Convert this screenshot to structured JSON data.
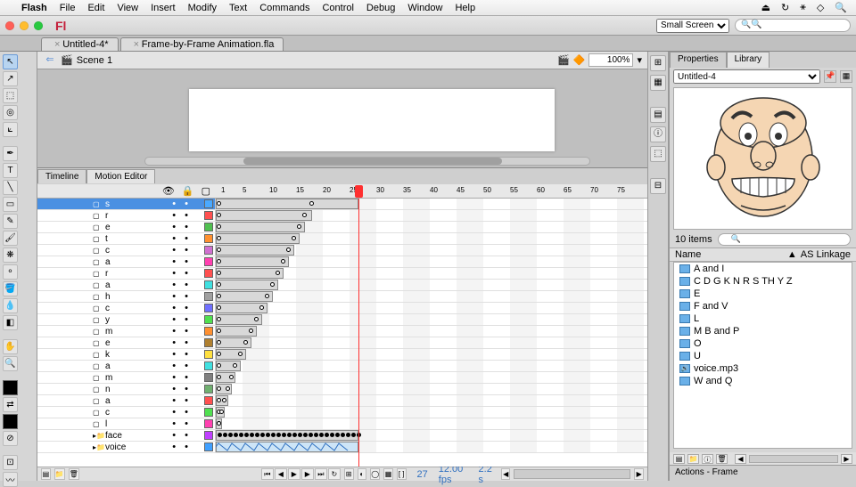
{
  "menubar": {
    "items": [
      "Flash",
      "File",
      "Edit",
      "View",
      "Insert",
      "Modify",
      "Text",
      "Commands",
      "Control",
      "Debug",
      "Window",
      "Help"
    ]
  },
  "titlebar": {
    "logo": "Fl",
    "workspace": "Small Screen",
    "search_placeholder": ""
  },
  "doctabs": [
    {
      "label": "Untitled-4*"
    },
    {
      "label": "Frame-by-Frame Animation.fla"
    }
  ],
  "scenebar": {
    "scene": "Scene 1",
    "zoom": "100%"
  },
  "timeline": {
    "tabs": [
      "Timeline",
      "Motion Editor"
    ],
    "ruler_ticks": [
      1,
      5,
      10,
      15,
      20,
      25,
      30,
      35,
      40,
      45,
      50,
      55,
      60,
      65,
      70,
      75
    ],
    "playhead_frame": 27,
    "status": {
      "frame": "27",
      "fps": "12.00 fps",
      "time": "2.2 s"
    },
    "layers": [
      {
        "name": "s",
        "color": "#4aa9ff",
        "selected": true,
        "start": 0,
        "end": 160,
        "kfs": [
          0,
          108
        ]
      },
      {
        "name": "r",
        "color": "#ff5050",
        "start": 0,
        "end": 108,
        "kfs": [
          0,
          100
        ]
      },
      {
        "name": "e",
        "color": "#50c050",
        "start": 0,
        "end": 100,
        "kfs": [
          0,
          94
        ]
      },
      {
        "name": "t",
        "color": "#ff9030",
        "start": 0,
        "end": 94,
        "kfs": [
          0,
          88
        ]
      },
      {
        "name": "c",
        "color": "#d070d0",
        "start": 0,
        "end": 88,
        "kfs": [
          0,
          82
        ]
      },
      {
        "name": "a",
        "color": "#ff40b0",
        "start": 0,
        "end": 82,
        "kfs": [
          0,
          76
        ]
      },
      {
        "name": "r",
        "color": "#ff5050",
        "start": 0,
        "end": 76,
        "kfs": [
          0,
          70
        ]
      },
      {
        "name": "a",
        "color": "#40e0e0",
        "start": 0,
        "end": 70,
        "kfs": [
          0,
          64
        ]
      },
      {
        "name": "h",
        "color": "#a0a0a0",
        "start": 0,
        "end": 64,
        "kfs": [
          0,
          58
        ]
      },
      {
        "name": "c",
        "color": "#7070ff",
        "start": 0,
        "end": 58,
        "kfs": [
          0,
          52
        ]
      },
      {
        "name": "y",
        "color": "#50e050",
        "start": 0,
        "end": 52,
        "kfs": [
          0,
          46
        ]
      },
      {
        "name": "m",
        "color": "#ff9030",
        "start": 0,
        "end": 46,
        "kfs": [
          0,
          40
        ]
      },
      {
        "name": "e",
        "color": "#b08030",
        "start": 0,
        "end": 40,
        "kfs": [
          0,
          34
        ]
      },
      {
        "name": "k",
        "color": "#ffe040",
        "start": 0,
        "end": 34,
        "kfs": [
          0,
          28
        ]
      },
      {
        "name": "a",
        "color": "#40e0e0",
        "start": 0,
        "end": 28,
        "kfs": [
          0,
          22
        ]
      },
      {
        "name": "m",
        "color": "#808080",
        "start": 0,
        "end": 22,
        "kfs": [
          0,
          18
        ]
      },
      {
        "name": "n",
        "color": "#70b070",
        "start": 0,
        "end": 18,
        "kfs": [
          0,
          14
        ]
      },
      {
        "name": "a",
        "color": "#ff5050",
        "start": 0,
        "end": 14,
        "kfs": [
          0,
          10
        ]
      },
      {
        "name": "c",
        "color": "#50e050",
        "start": 0,
        "end": 10,
        "kfs": [
          0,
          7
        ]
      },
      {
        "name": "l",
        "color": "#ff40b0",
        "start": 0,
        "end": 7,
        "kfs": [
          0,
          4
        ]
      },
      {
        "name": "face",
        "color": "#c040ff",
        "folder": true,
        "start": 0,
        "end": 160,
        "kfs": "many"
      },
      {
        "name": "voice",
        "color": "#40a0ff",
        "folder": true,
        "start": 0,
        "end": 160,
        "audio": true
      }
    ]
  },
  "library": {
    "tabs": [
      "Properties",
      "Library"
    ],
    "doc_dropdown": "Untitled-4",
    "count": "10 items",
    "columns": [
      "Name",
      "AS Linkage"
    ],
    "items": [
      {
        "name": "A and I",
        "type": "graphic"
      },
      {
        "name": "C D G K N R S TH Y Z",
        "type": "graphic"
      },
      {
        "name": "E",
        "type": "graphic"
      },
      {
        "name": "F and V",
        "type": "graphic"
      },
      {
        "name": "L",
        "type": "graphic"
      },
      {
        "name": "M B and P",
        "type": "graphic"
      },
      {
        "name": "O",
        "type": "graphic"
      },
      {
        "name": "U",
        "type": "graphic"
      },
      {
        "name": "voice.mp3",
        "type": "sound"
      },
      {
        "name": "W and Q",
        "type": "graphic"
      }
    ]
  },
  "actions_panel": "Actions - Frame"
}
